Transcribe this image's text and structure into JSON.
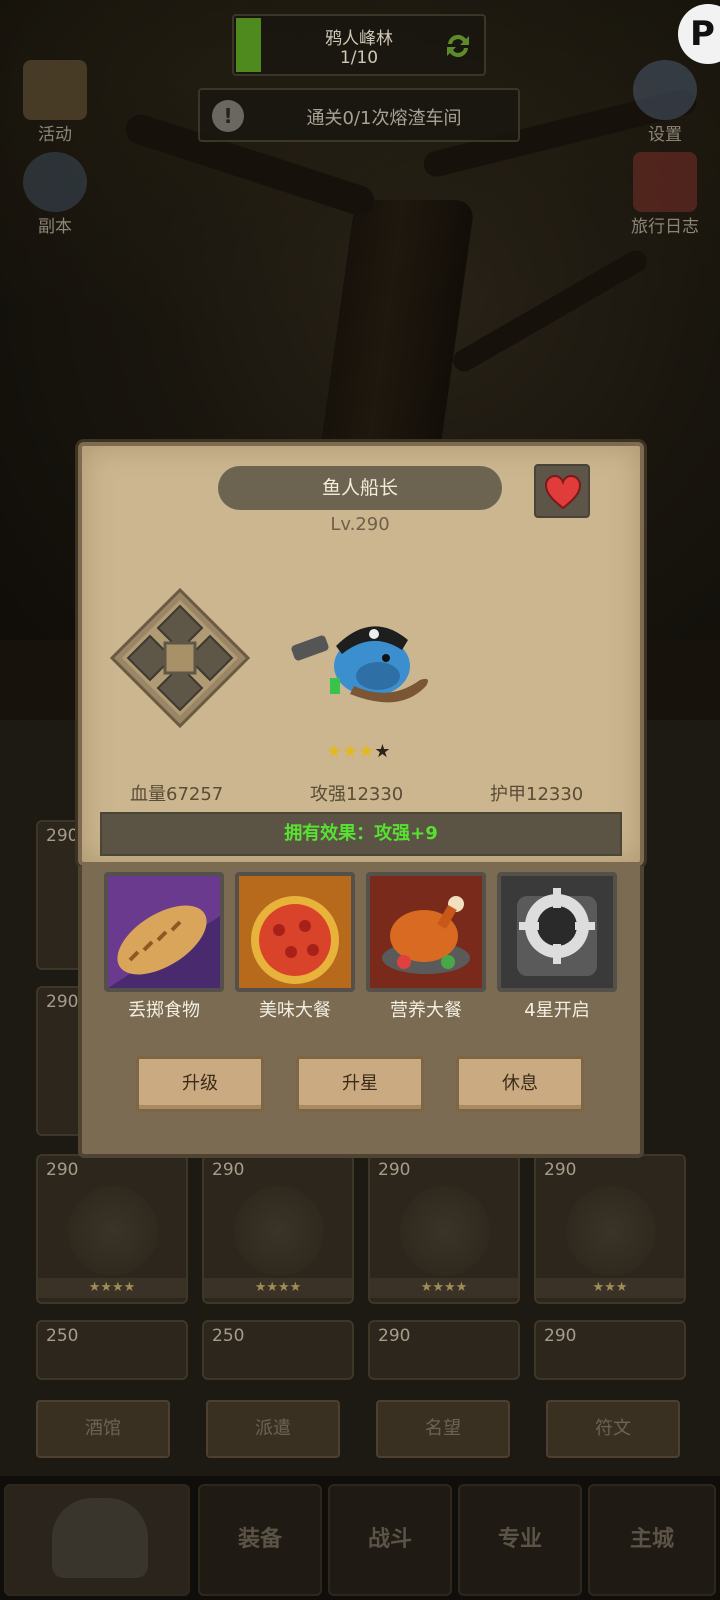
{
  "stage": {
    "name": "鸦人峰林",
    "progress": "1/10",
    "progress_fraction": 0.1
  },
  "quest": {
    "text": "通关0/1次熔渣车间"
  },
  "side_buttons": {
    "activity": "活动",
    "dungeon": "副本",
    "settings": "设置",
    "travel_log": "旅行日志"
  },
  "pause_glyph": "P",
  "modal": {
    "hero_name": "鱼人船长",
    "level": "Lv.290",
    "stars_filled": 3,
    "stars_total": 4,
    "stats": {
      "hp": "血量67257",
      "attack": "攻强12330",
      "armor": "护甲12330"
    },
    "effect": "拥有效果：攻强+9",
    "skills": [
      {
        "label": "丢掷食物",
        "icon": "bread-icon"
      },
      {
        "label": "美味大餐",
        "icon": "pizza-icon"
      },
      {
        "label": "营养大餐",
        "icon": "roast-chicken-icon"
      },
      {
        "label": "4星开启",
        "icon": "locked-gear-icon"
      }
    ],
    "actions": {
      "upgrade": "升级",
      "star_up": "升星",
      "rest": "休息"
    }
  },
  "grid": {
    "row1": [
      "290",
      "290",
      "290",
      "290"
    ],
    "row2": [
      "250",
      "250",
      "290",
      "290"
    ],
    "hidden_left": [
      "290",
      "290"
    ]
  },
  "tabs": [
    "酒馆",
    "派遣",
    "名望",
    "符文"
  ],
  "nav": {
    "followers": "随从",
    "equipment": "装备",
    "battle": "战斗",
    "profession": "专业",
    "main_city": "主城"
  },
  "colors": {
    "effect_text": "#58e032",
    "star": "#e6b81f",
    "parchment": "#cbb690"
  }
}
